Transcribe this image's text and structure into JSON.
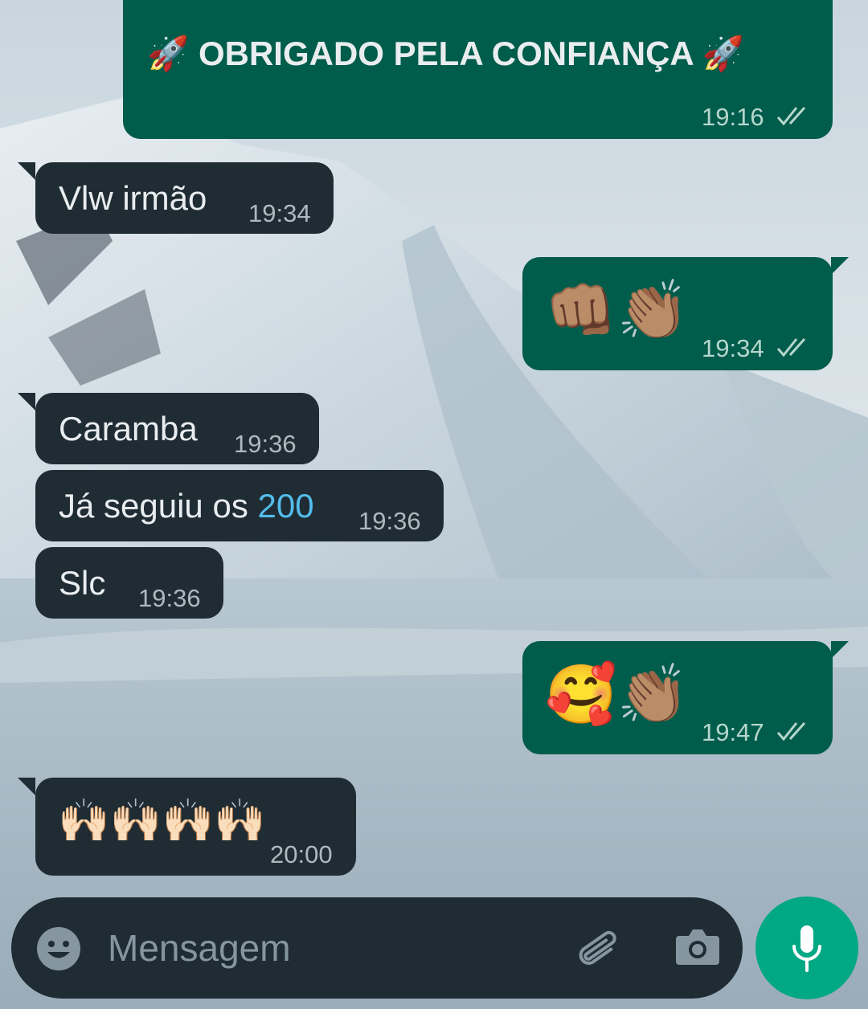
{
  "chat": {
    "messages": [
      {
        "direction": "out",
        "text": "🚀 OBRIGADO PELA CONFIANÇA 🚀",
        "time": "19:16",
        "status": "read"
      },
      {
        "direction": "in",
        "text": "Vlw irmão",
        "time": "19:34"
      },
      {
        "direction": "out",
        "text": "👊🏽👏🏽",
        "time": "19:34",
        "status": "read"
      },
      {
        "direction": "in",
        "text": "Caramba",
        "time": "19:36"
      },
      {
        "direction": "in",
        "text_prefix": "Já seguiu os ",
        "link": "200",
        "time": "19:36"
      },
      {
        "direction": "in",
        "text": "Slc",
        "time": "19:36"
      },
      {
        "direction": "out",
        "text": "🥰👏🏽",
        "time": "19:47",
        "status": "read"
      },
      {
        "direction": "in",
        "text": "🙌🏻🙌🏻🙌🏻🙌🏻",
        "time": "20:00"
      }
    ]
  },
  "input": {
    "placeholder": "Mensagem",
    "emoji_icon": "emoji-icon",
    "attach_icon": "paperclip-icon",
    "camera_icon": "camera-icon",
    "mic_icon": "mic-icon"
  },
  "colors": {
    "incoming_bubble": "#1f2c34",
    "outgoing_bubble": "#005c4b",
    "accent": "#00a884",
    "link": "#53bdeb",
    "read_ticks": "#b6d6cc"
  }
}
